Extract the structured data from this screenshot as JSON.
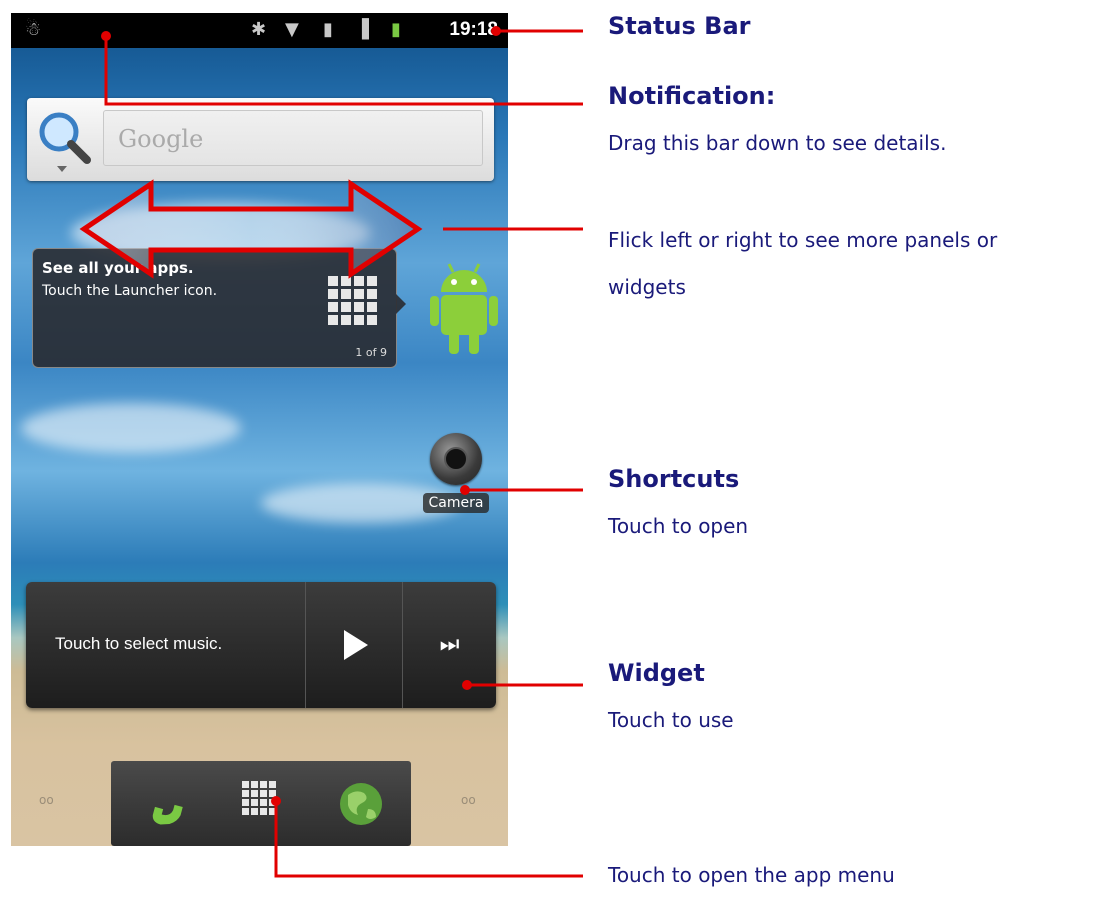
{
  "status_bar": {
    "time": "19:18",
    "icons": [
      "android-debug-icon",
      "bluetooth-icon",
      "wifi-icon",
      "sim-icon",
      "signal-icon",
      "battery-charging-icon"
    ]
  },
  "search": {
    "placeholder": "Google"
  },
  "tip_card": {
    "title": "See all your apps.",
    "body": "Touch the Launcher icon.",
    "page": "1 of 9"
  },
  "camera": {
    "label": "Camera"
  },
  "music_widget": {
    "text": "Touch to select music."
  },
  "dock": {
    "items": [
      "phone-icon",
      "launcher-grid-icon",
      "browser-globe-icon"
    ]
  },
  "page_indicators": {
    "left": "oo",
    "right": "oo"
  },
  "annotations": {
    "status_bar": {
      "title": "Status Bar"
    },
    "notification": {
      "title": "Notification:",
      "text": "Drag this bar down to see details."
    },
    "flick": {
      "line1": "Flick left or right to see more panels or",
      "line2": "widgets"
    },
    "shortcuts": {
      "title": "Shortcuts",
      "text": "Touch to open"
    },
    "widget": {
      "title": "Widget",
      "text": "Touch to use"
    },
    "app_menu": {
      "text": "Touch to open the app menu"
    }
  },
  "colors": {
    "annotation_text": "#1a1a7a",
    "annotation_line": "#e10000"
  }
}
